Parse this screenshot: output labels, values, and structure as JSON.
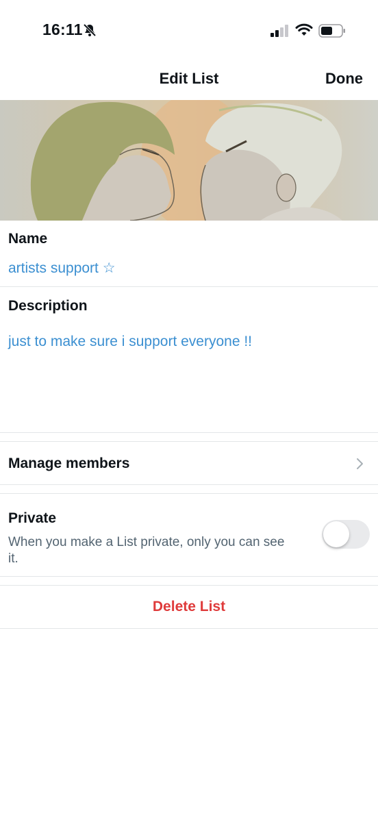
{
  "status_bar": {
    "time": "16:11"
  },
  "nav": {
    "title": "Edit List",
    "done_label": "Done"
  },
  "form": {
    "name_label": "Name",
    "name_value": "artists support ☆",
    "description_label": "Description",
    "description_value": "just to make sure i support everyone !!"
  },
  "manage": {
    "label": "Manage members"
  },
  "private": {
    "label": "Private",
    "description": "When you make a List private, only you can see it.",
    "enabled": false
  },
  "delete": {
    "label": "Delete List"
  },
  "colors": {
    "accent_link": "#3b8fd1",
    "danger": "#df3b3b",
    "toggle_off": "#e9eaec"
  }
}
